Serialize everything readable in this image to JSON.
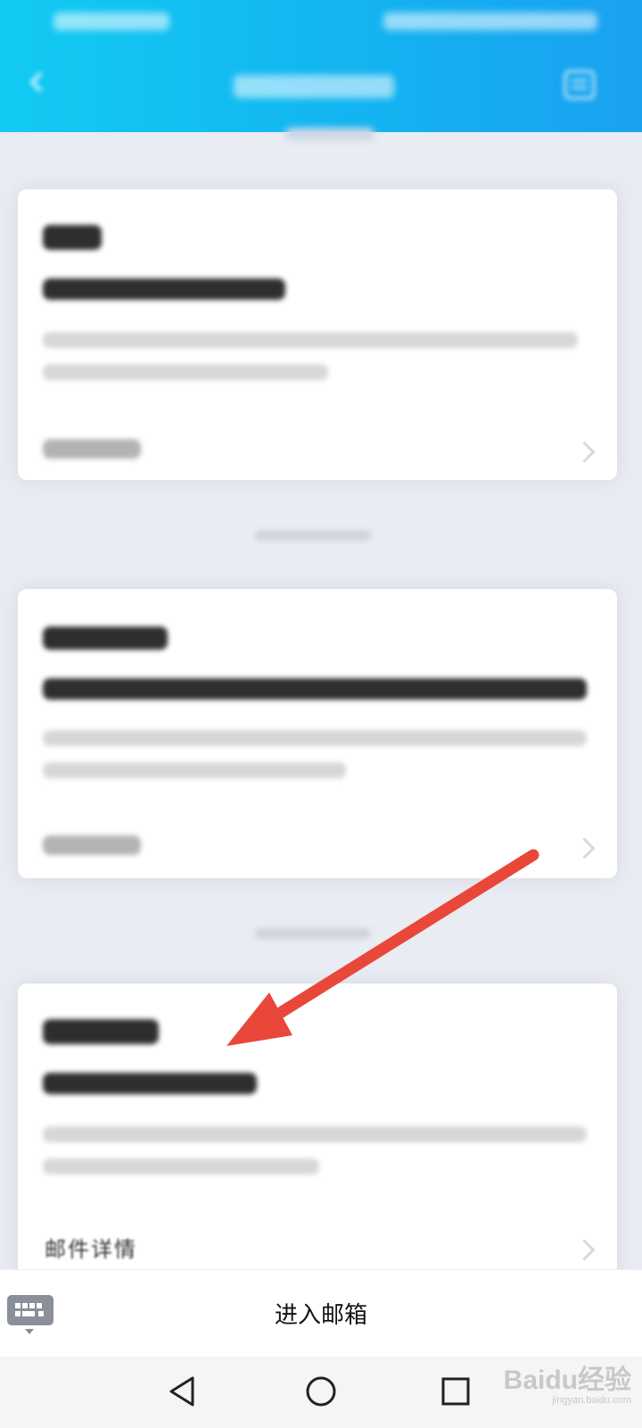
{
  "bottom_bar": {
    "enter_mailbox_label": "进入邮箱"
  },
  "card3": {
    "detail_label": "邮件详情"
  },
  "watermark": {
    "brand": "Baidu经验",
    "url": "jingyan.baidu.com"
  },
  "colors": {
    "header_gradient_start": "#12cbf3",
    "header_gradient_end": "#1aa1f0",
    "arrow": "#e8473a",
    "page_background": "#e9ecf2"
  },
  "icons": {
    "back": "back-arrow-icon",
    "menu": "menu-icon",
    "keyboard": "keyboard-icon",
    "nav_back": "triangle-back-icon",
    "nav_home": "circle-home-icon",
    "nav_recent": "square-recent-icon"
  }
}
